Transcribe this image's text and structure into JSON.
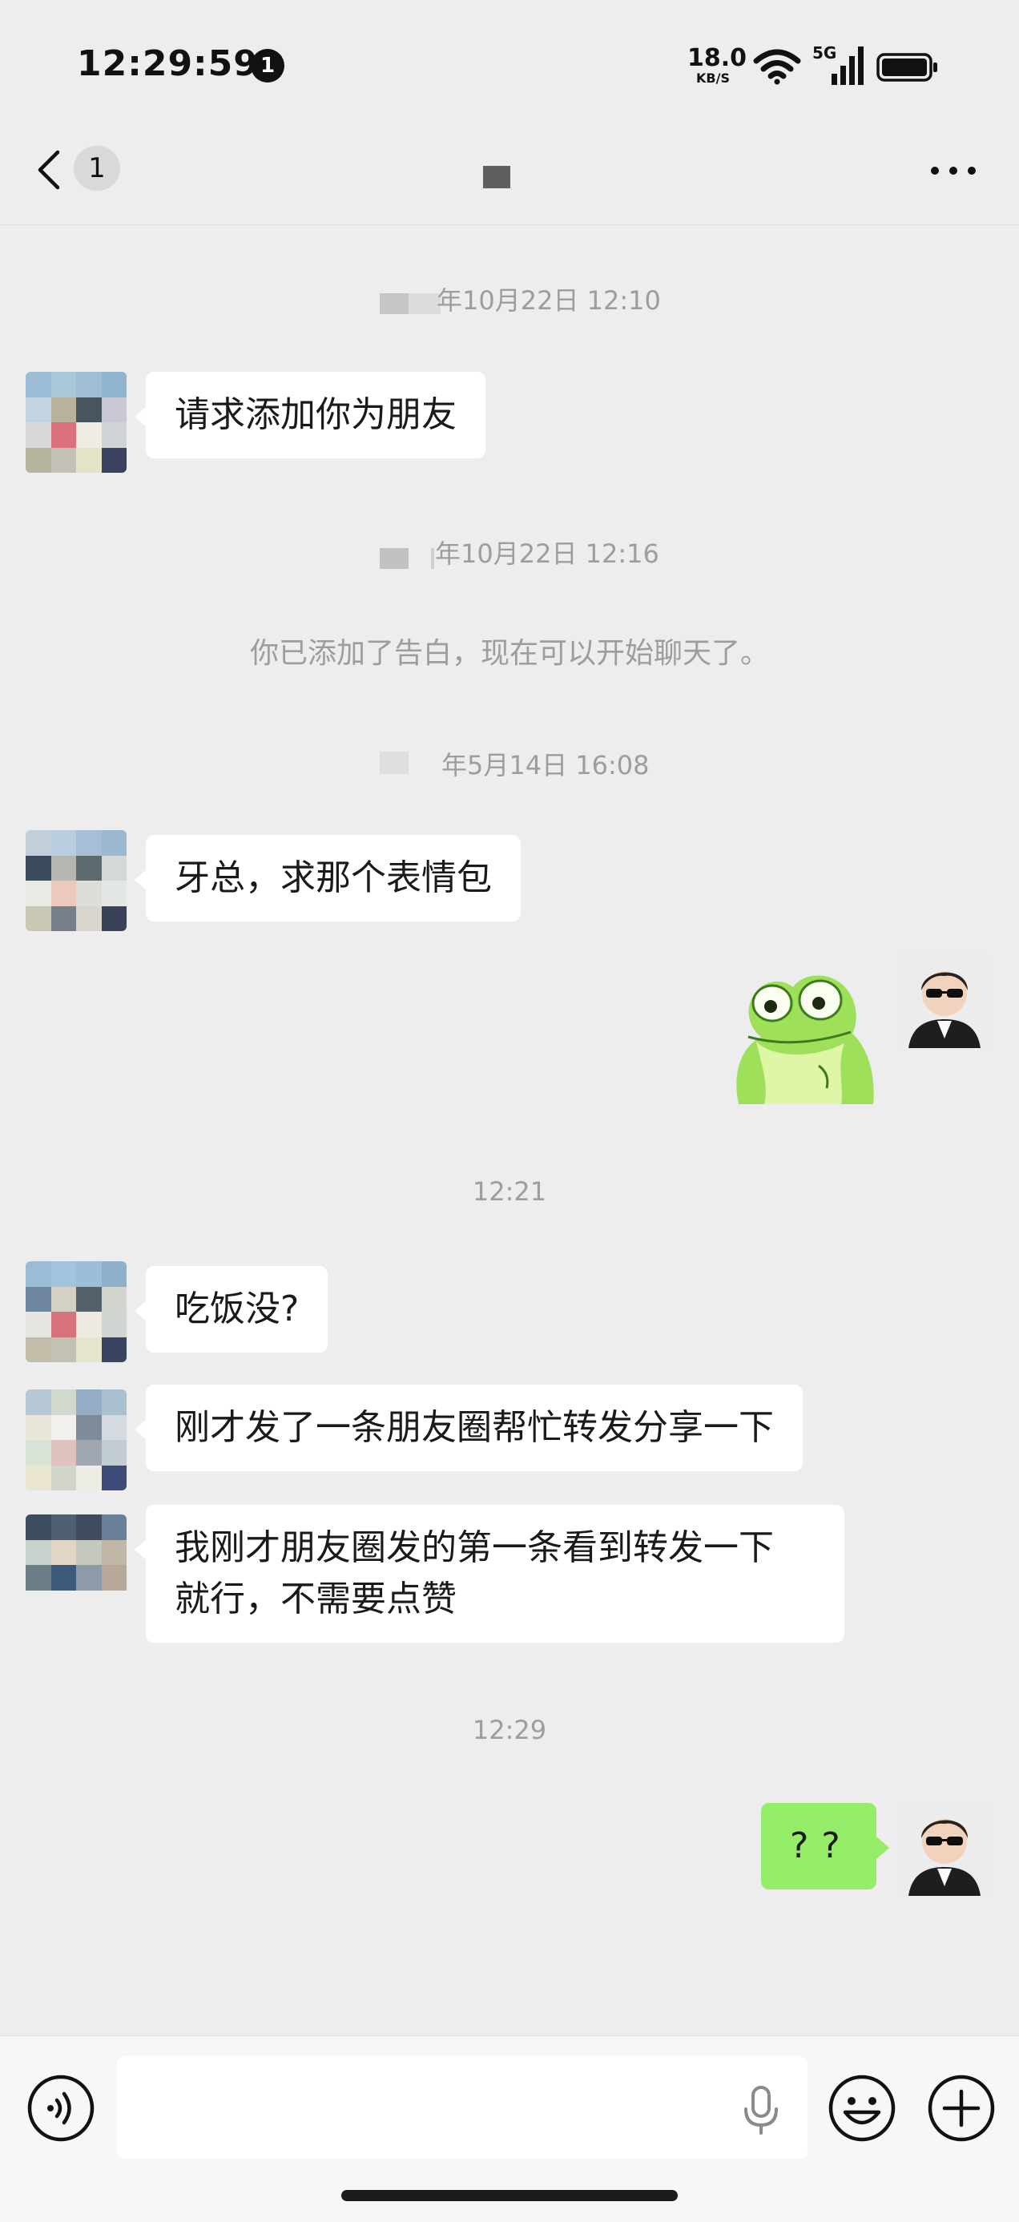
{
  "status_bar": {
    "time": "12:29:59",
    "notification_count": "1",
    "net_speed_value": "18.0",
    "net_speed_unit": "KB/S",
    "network_label": "5G"
  },
  "nav": {
    "back_icon": "chevron-left-icon",
    "unread_count": "1",
    "more_icon": "more-horizontal-icon"
  },
  "timestamps": {
    "t1": "年10月22日 12:10",
    "t2": "年10月22日 12:16",
    "t3": "年5月14日 16:08",
    "t4": "12:21",
    "t5": "12:29"
  },
  "messages": {
    "m1": "请求添加你为朋友",
    "system": "你已添加了告白，现在可以开始聊天了。",
    "m2": "牙总，求那个表情包",
    "m3": "吃饭没?",
    "m4": "刚才发了一条朋友圈帮忙转发分享一下",
    "m5_line1": "我刚才朋友圈发的第一条看到转发一下",
    "m5_line2": "就行，不需要点赞",
    "mine_last": "??"
  },
  "bottom_bar": {
    "voice_icon": "voice-icon",
    "mic_icon": "mic-icon",
    "emoji_icon": "emoji-icon",
    "plus_icon": "plus-icon",
    "input_value": ""
  },
  "colors": {
    "background": "#ededed",
    "my_bubble": "#95ec69",
    "their_bubble": "#ffffff",
    "timestamp": "#9d9d9d"
  }
}
